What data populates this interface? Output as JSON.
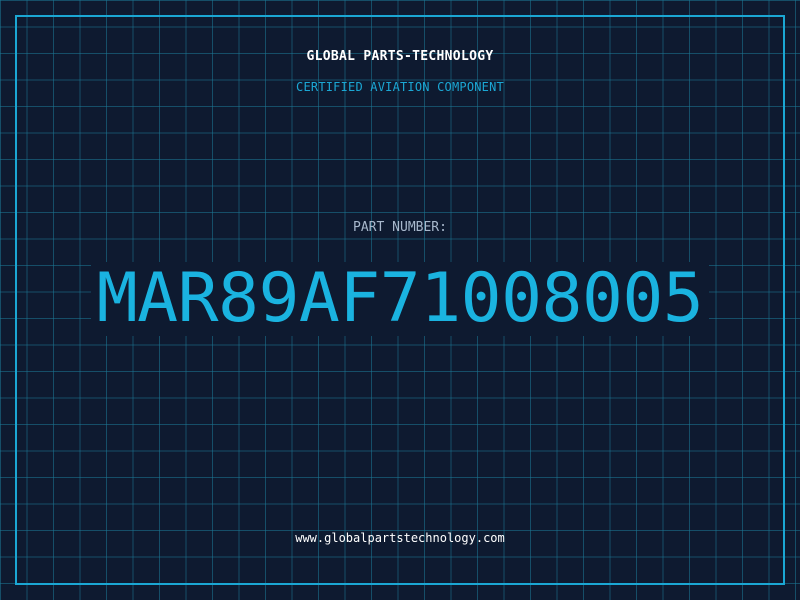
{
  "header": {
    "company": "GLOBAL PARTS-TECHNOLOGY",
    "subtitle": "CERTIFIED AVIATION COMPONENT"
  },
  "part": {
    "label": "PART NUMBER:",
    "number": "MAR89AF71008005"
  },
  "footer": {
    "url": "www.globalpartstechnology.com"
  },
  "colors": {
    "background": "#0e1a30",
    "accent": "#1ab3e0",
    "frame": "#1ba7d4",
    "grid": "#1c7896",
    "label": "#a8b8cc",
    "text": "#ffffff"
  }
}
